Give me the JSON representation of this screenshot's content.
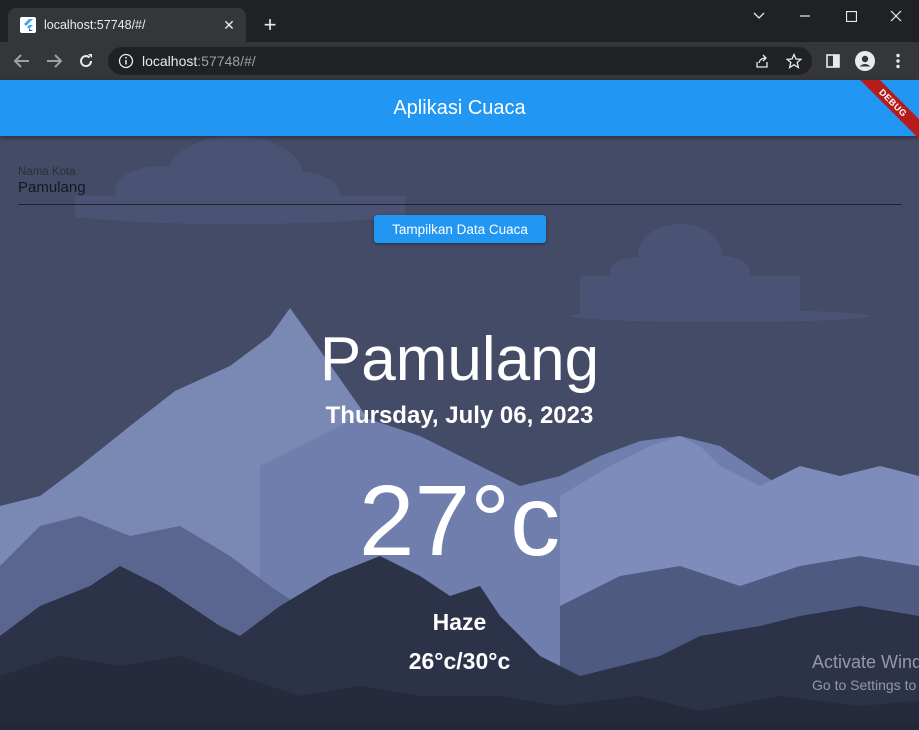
{
  "browser": {
    "tab_title": "localhost:57748/#/",
    "url_host": "localhost",
    "url_rest": ":57748/#/"
  },
  "app": {
    "title": "Aplikasi Cuaca",
    "debug_banner": "DEBUG"
  },
  "form": {
    "city_label": "Nama Kota",
    "city_value": "Pamulang",
    "submit_label": "Tampilkan Data Cuaca"
  },
  "weather": {
    "city": "Pamulang",
    "date": "Thursday, July 06, 2023",
    "temperature": "27°c",
    "condition": "Haze",
    "min_max": "26°c/30°c"
  },
  "watermark": {
    "title": "Activate Windows",
    "subtitle": "Go to Settings to activate Windows."
  },
  "colors": {
    "accent": "#2196f3",
    "sky": "#434b66",
    "debug": "#b71c1c"
  }
}
